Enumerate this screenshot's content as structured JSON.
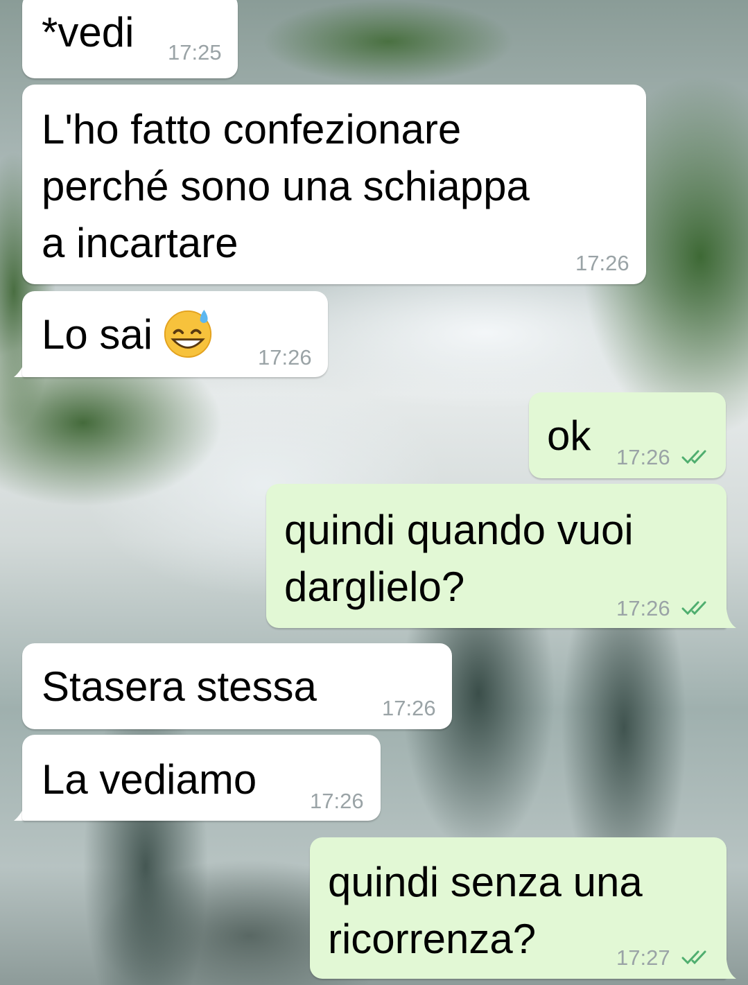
{
  "messages": [
    {
      "text": "*vedi",
      "time": "17:25",
      "direction": "incoming"
    },
    {
      "text": "L'ho fatto confezionare\nperché sono una schiappa\na incartare",
      "time": "17:26",
      "direction": "incoming"
    },
    {
      "text": "Lo sai",
      "emoji": "sweat-smile-emoji",
      "time": "17:26",
      "direction": "incoming"
    },
    {
      "text": "ok",
      "time": "17:26",
      "direction": "outgoing",
      "status": "read"
    },
    {
      "text": "quindi quando vuoi\ndarglielo?",
      "time": "17:26",
      "direction": "outgoing",
      "status": "read"
    },
    {
      "text": "Stasera stessa",
      "time": "17:26",
      "direction": "incoming"
    },
    {
      "text": "La vediamo",
      "time": "17:26",
      "direction": "incoming"
    },
    {
      "text": "quindi senza una\nricorrenza?",
      "time": "17:27",
      "direction": "outgoing",
      "status": "read"
    }
  ],
  "colors": {
    "incoming_bubble": "#ffffff",
    "outgoing_bubble": "#e2f8d5",
    "timestamp": "#9aa3a6",
    "read_ticks": "#4fc3f7"
  }
}
